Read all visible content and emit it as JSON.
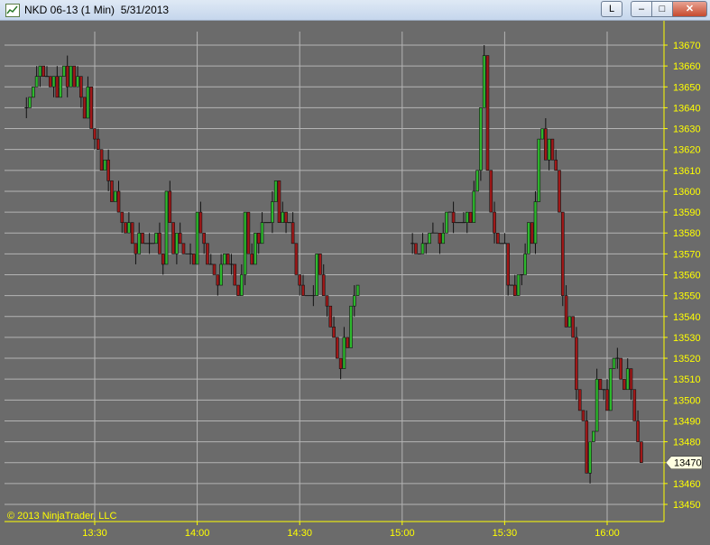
{
  "window": {
    "title": "NKD 06-13 (1 Min)  5/31/2013",
    "buttons": {
      "l_label": "L",
      "minimize_label": "–",
      "maximize_label": "□",
      "close_label": "✕"
    }
  },
  "copyright": "© 2013 NinjaTrader, LLC",
  "colors": {
    "background": "#6b6b6b",
    "grid": "#b4b4b4",
    "axis": "#ffff00",
    "up_candle": "#2db82d",
    "down_candle": "#a01818",
    "doji": "#111111",
    "price_marker": "#ffffe0"
  },
  "chart_data": {
    "type": "candlestick",
    "symbol": "NKD 06-13",
    "interval": "1 Min",
    "date": "5/31/2013",
    "x_ticks": [
      "13:30",
      "14:00",
      "14:30",
      "15:00",
      "15:30",
      "16:00"
    ],
    "y_ticks": [
      13450,
      13460,
      13470,
      13480,
      13490,
      13500,
      13510,
      13520,
      13530,
      13540,
      13550,
      13560,
      13570,
      13580,
      13590,
      13600,
      13610,
      13620,
      13630,
      13640,
      13650,
      13660,
      13670
    ],
    "ylim": [
      13445,
      13675
    ],
    "grid": true,
    "last_price": 13470,
    "ohlc_segments": [
      {
        "start": "13:10",
        "closes": [
          13640,
          13645,
          13650,
          13655,
          13660,
          13655,
          13655,
          13650,
          13655,
          13645,
          13655,
          13660,
          13650,
          13660,
          13650,
          13655,
          13645,
          13635,
          13650,
          13630,
          13625,
          13620,
          13610,
          13615,
          13605,
          13595,
          13600,
          13590,
          13585,
          13580,
          13585,
          13575,
          13570,
          13580,
          13575,
          13575,
          13575,
          13575,
          13580,
          13570,
          13565,
          13600,
          13585,
          13570,
          13580,
          13575,
          13570,
          13570,
          13570,
          13565,
          13590,
          13580,
          13575,
          13565,
          13565,
          13560,
          13555,
          13565,
          13570,
          13565,
          13565,
          13555,
          13550,
          13560,
          13590,
          13570,
          13565,
          13580,
          13575,
          13585,
          13585,
          13585,
          13595,
          13605,
          13585,
          13590,
          13585,
          13585,
          13575,
          13560,
          13555,
          13550,
          13550,
          13550,
          13550,
          13570,
          13560,
          13550,
          13545,
          13535,
          13530,
          13520,
          13515,
          13530,
          13525,
          13545,
          13550,
          13555
        ]
      },
      {
        "start": "15:03",
        "closes": [
          13575,
          13570,
          13570,
          13575,
          13575,
          13580,
          13580,
          13580,
          13575,
          13580,
          13590,
          13590,
          13585,
          13585,
          13585,
          13585,
          13590,
          13585,
          13600,
          13610,
          13640,
          13665,
          13610,
          13590,
          13580,
          13575,
          13575,
          13575,
          13555,
          13555,
          13550,
          13560,
          13560,
          13570,
          13585,
          13575,
          13595,
          13625,
          13630,
          13615,
          13625,
          13615,
          13610,
          13590,
          13550,
          13535,
          13540,
          13530,
          13505,
          13495,
          13490,
          13465,
          13480,
          13485,
          13510,
          13505,
          13505,
          13495,
          13515,
          13520,
          13520,
          13510,
          13505,
          13515,
          13505,
          13490,
          13480,
          13470
        ]
      }
    ]
  }
}
